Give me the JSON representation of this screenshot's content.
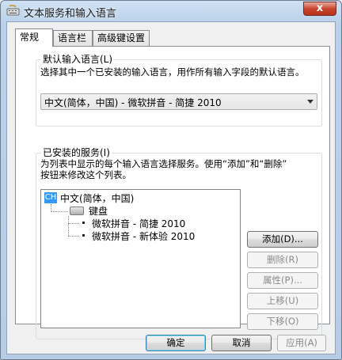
{
  "window": {
    "title": "文本服务和输入语言",
    "close_glyph": "x"
  },
  "tabs": [
    {
      "label": "常规",
      "active": true
    },
    {
      "label": "语言栏",
      "active": false
    },
    {
      "label": "高级键设置",
      "active": false
    }
  ],
  "default_language": {
    "legend": "默认输入语言(L)",
    "description": "选择其中一个已安装的输入语言，用作所有输入字段的默认语言。",
    "selected": "中文(简体，中国) - 微软拼音 - 简捷 2010"
  },
  "installed_services": {
    "legend": "已安装的服务(I)",
    "description_line1": "为列表中显示的每个输入语言选择服务。使用“添加”和“删除”",
    "description_line2": "按钮来修改这个列表。",
    "tree": {
      "language_badge": "CH",
      "language": "中文(简体，中国)",
      "category": "键盘",
      "items": [
        "微软拼音 - 简捷 2010",
        "微软拼音 - 新体验 2010"
      ]
    },
    "buttons": {
      "add": "添加(D)...",
      "remove": "删除(R)",
      "properties": "属性(P)...",
      "move_up": "上移(U)",
      "move_down": "下移(O)"
    }
  },
  "footer": {
    "ok": "确定",
    "cancel": "取消",
    "apply": "应用(A)"
  },
  "colors": {
    "accent": "#3399ff",
    "title_bg": "#b9d1ea",
    "close": "#c7472e"
  }
}
